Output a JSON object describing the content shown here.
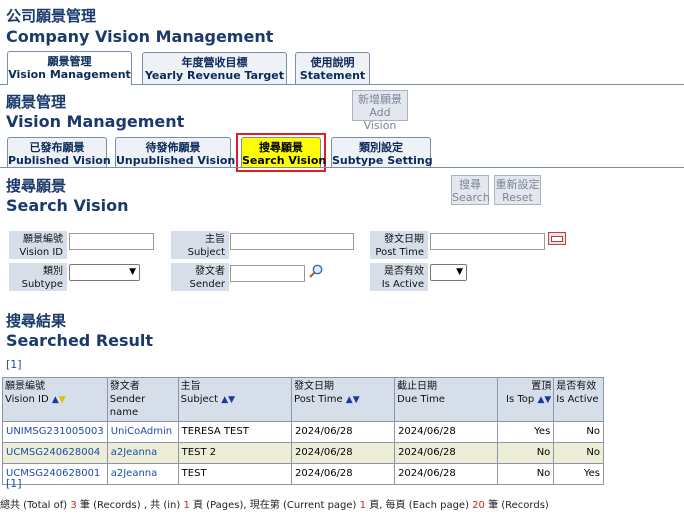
{
  "company": {
    "title_zh": "公司願景管理",
    "title_en": "Company Vision Management"
  },
  "top_tabs": [
    {
      "zh": "願景管理",
      "en": "Vision Management"
    },
    {
      "zh": "年度營收目標",
      "en": "Yearly Revenue Target"
    },
    {
      "zh": "使用說明",
      "en": "Statement"
    }
  ],
  "vision": {
    "title_zh": "願景管理",
    "title_en": "Vision Management",
    "add_zh": "新增願景",
    "add_en": "Add Vision"
  },
  "sub_tabs": [
    {
      "zh": "已發布願景",
      "en": "Published Vision"
    },
    {
      "zh": "待發佈願景",
      "en": "Unpublished Vision"
    },
    {
      "zh": "搜尋願景",
      "en": "Search Vision"
    },
    {
      "zh": "類別設定",
      "en": "Subtype Setting"
    }
  ],
  "search": {
    "title_zh": "搜尋願景",
    "title_en": "Search Vision",
    "search_zh": "搜尋",
    "search_en": "Search",
    "reset_zh": "重新設定",
    "reset_en": "Reset",
    "fields": {
      "vision_id": {
        "zh": "願景編號",
        "en": "Vision ID",
        "value": ""
      },
      "subject": {
        "zh": "主旨",
        "en": "Subject",
        "value": ""
      },
      "post_time": {
        "zh": "發文日期",
        "en": "Post Time",
        "value": ""
      },
      "subtype": {
        "zh": "類別",
        "en": "Subtype",
        "value": ""
      },
      "sender": {
        "zh": "發文者",
        "en": "Sender",
        "value": ""
      },
      "is_active": {
        "zh": "是否有效",
        "en": "Is Active",
        "value": ""
      }
    }
  },
  "results": {
    "title_zh": "搜尋結果",
    "title_en": "Searched Result",
    "pager_top": "[1]",
    "pager_bottom": "[1]",
    "columns": [
      {
        "zh": "願景編號",
        "en": "Vision ID"
      },
      {
        "zh": "發文者",
        "en": "Sender name"
      },
      {
        "zh": "主旨",
        "en": "Subject"
      },
      {
        "zh": "發文日期",
        "en": "Post Time"
      },
      {
        "zh": "截止日期",
        "en": "Due Time"
      },
      {
        "zh": "置頂",
        "en": "Is Top"
      },
      {
        "zh": "是否有效",
        "en": "Is Active"
      }
    ],
    "rows": [
      {
        "id": "UNIMSG231005003",
        "sender": "UniCoAdmin",
        "subject": "TERESA TEST",
        "post": "2024/06/28",
        "due": "2024/06/28",
        "top": "Yes",
        "active": "No"
      },
      {
        "id": "UCMSG240628004",
        "sender": "a2Jeanna",
        "subject": "TEST 2",
        "post": "2024/06/28",
        "due": "2024/06/28",
        "top": "No",
        "active": "No"
      },
      {
        "id": "UCMSG240628001",
        "sender": "a2Jeanna",
        "subject": "TEST",
        "post": "2024/06/28",
        "due": "2024/06/28",
        "top": "No",
        "active": "Yes"
      }
    ],
    "summary": {
      "p1": "總共 (Total of) ",
      "records": "3",
      "p2": " 筆 (Records) , 共 (in) ",
      "pages": "1",
      "p3": " 頁 (Pages), 現在第 (Current page) ",
      "current": "1",
      "p4": " 頁, 每頁 (Each page) ",
      "each": "20",
      "p5": " 筆 (Records)"
    }
  },
  "colors": {
    "title": "#1a3a6b",
    "link": "#1a4ea8",
    "highlight_tab": "#ffff00",
    "highlight_border": "#e02020"
  }
}
